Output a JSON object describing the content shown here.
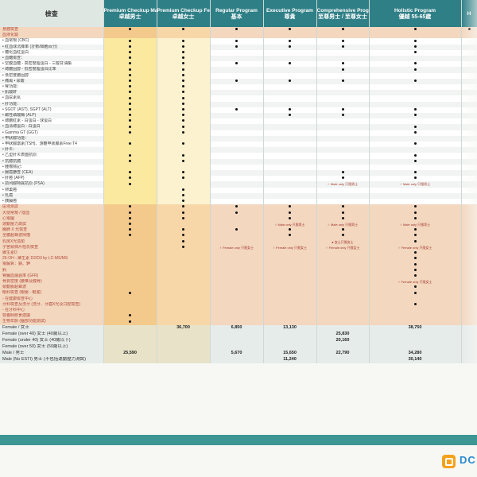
{
  "brand_text": "DC",
  "columns": [
    {
      "en": "檢查",
      "zh": ""
    },
    {
      "en": "Premium Checkup Male",
      "zh": "卓越男士"
    },
    {
      "en": "Premium Checkup Female",
      "zh": "卓越女士"
    },
    {
      "en": "Regular Program",
      "zh": "基本"
    },
    {
      "en": "Executive Program",
      "zh": "尊貴"
    },
    {
      "en": "Comprehensive Program Male/Female",
      "zh": "至尊男士 / 至尊女士"
    },
    {
      "en": "Holistic Program",
      "zh": "優越 55-65歲"
    },
    {
      "en": "H",
      "zh": ""
    }
  ],
  "rows": [
    {
      "label": "身體檢查",
      "cat": true,
      "c": [
        "•",
        "•",
        "•",
        "•",
        "•",
        "•",
        "•"
      ]
    },
    {
      "label": "血液化驗",
      "cat": true,
      "c": [
        "",
        "",
        "",
        "",
        "",
        "",
        ""
      ]
    },
    {
      "label": "• 血常規 (CBC)",
      "c": [
        "•",
        "•",
        "•",
        "•",
        "•",
        "•",
        ""
      ]
    },
    {
      "label": "• 紅血球沉降率 (計數/細胞百分)",
      "c": [
        "•",
        "•",
        "•",
        "•",
        "•",
        "•",
        ""
      ]
    },
    {
      "label": "• 糖化血紅蛋白",
      "c": [
        "•",
        "•",
        "",
        "",
        "",
        "•",
        ""
      ]
    },
    {
      "label": "• 血糖檢查：",
      "c": [
        "•",
        "•",
        "",
        "",
        "",
        "",
        ""
      ]
    },
    {
      "label": "• 空腹血糖 - 高密度脂蛋白 - 三酸甘油酯",
      "c": [
        "•",
        "•",
        "•",
        "•",
        "•",
        "•",
        ""
      ]
    },
    {
      "label": "• 總膽固醇 - 低密度脂蛋白比率",
      "c": [
        "•",
        "•",
        "",
        "",
        "•",
        "•",
        ""
      ]
    },
    {
      "label": "• 低密度膽固醇",
      "c": [
        "•",
        "•",
        "",
        "",
        "",
        "",
        ""
      ]
    },
    {
      "label": "• 痛風 • 尿酸",
      "c": [
        "•",
        "•",
        "•",
        "•",
        "•",
        "•",
        ""
      ]
    },
    {
      "label": "• 腎功能：",
      "c": [
        "•",
        "•",
        "",
        "",
        "",
        "",
        ""
      ]
    },
    {
      "label": "• 肌酸酐",
      "c": [
        "•",
        "•",
        "",
        "",
        "",
        "",
        ""
      ]
    },
    {
      "label": "• 血尿素氮",
      "c": [
        "•",
        "•",
        "",
        "",
        "",
        "",
        ""
      ]
    },
    {
      "label": "• 肝功能：",
      "c": [
        "•",
        "•",
        "",
        "",
        "",
        "",
        ""
      ]
    },
    {
      "label": "• SGOT (AST), SGPT (ALT)",
      "c": [
        "•",
        "•",
        "•",
        "•",
        "•",
        "•",
        ""
      ]
    },
    {
      "label": "• 鹼性磷酸酶 (ALP)",
      "c": [
        "•",
        "•",
        "",
        "•",
        "•",
        "•",
        ""
      ]
    },
    {
      "label": "• 總膽紅素 - 白蛋白 - 球蛋白",
      "c": [
        "•",
        "•",
        "",
        "",
        "",
        "",
        ""
      ]
    },
    {
      "label": "• 血清總蛋白 - 白蛋白",
      "c": [
        "•",
        "•",
        "",
        "",
        "",
        "•",
        ""
      ]
    },
    {
      "label": "• Gamma GT (GGT)",
      "c": [
        "•",
        "•",
        "",
        "",
        "",
        "•",
        ""
      ]
    },
    {
      "label": "• 甲狀腺功能：",
      "c": [
        "",
        "",
        "",
        "",
        "",
        "",
        ""
      ]
    },
    {
      "label": "• 甲狀腺激素(TSH)、游離甲狀腺素Free T4",
      "c": [
        "•",
        "•",
        "",
        "",
        "",
        "•",
        ""
      ]
    },
    {
      "label": "• 肝炎：",
      "c": [
        "",
        "",
        "",
        "",
        "",
        "",
        ""
      ]
    },
    {
      "label": "• 乙型肝炎表面抗原",
      "c": [
        "•",
        "•",
        "",
        "",
        "",
        "•",
        ""
      ]
    },
    {
      "label": "• 抗體抗體",
      "c": [
        "•",
        "•",
        "",
        "",
        "",
        "•",
        ""
      ]
    },
    {
      "label": "• 腫瘤標記：",
      "c": [
        "",
        "",
        "",
        "",
        "",
        "",
        ""
      ]
    },
    {
      "label": "• 腸癌篩查 (CEA)",
      "c": [
        "•",
        "•",
        "",
        "",
        "•",
        "•",
        ""
      ]
    },
    {
      "label": "• 肝癌 (AFP)",
      "c": [
        "•",
        "•",
        "",
        "",
        "•",
        "•",
        ""
      ]
    },
    {
      "label": "• 前列腺特異抗原 (PSA)",
      "c": [
        "•",
        "",
        "",
        "",
        "♂ Male only 只限男士",
        "♂ Male only 只限男士",
        ""
      ]
    },
    {
      "label": "• 卵巢癌",
      "c": [
        "",
        "•",
        "",
        "",
        "",
        "",
        ""
      ]
    },
    {
      "label": "• 乳癌",
      "c": [
        "",
        "•",
        "",
        "",
        "",
        "",
        ""
      ]
    },
    {
      "label": "• 胰臟癌",
      "c": [
        "",
        "•",
        "",
        "",
        "",
        "",
        ""
      ]
    },
    {
      "label": "尿液測試",
      "cat": true,
      "c": [
        "•",
        "•",
        "•",
        "•",
        "•",
        "•",
        ""
      ]
    },
    {
      "label": "大便常規 / 隱血",
      "cat": true,
      "c": [
        "•",
        "•",
        "•",
        "•",
        "•",
        "•",
        ""
      ]
    },
    {
      "label": "心電圖",
      "cat": true,
      "c": [
        "•",
        "•",
        "",
        "•",
        "•",
        "•",
        ""
      ]
    },
    {
      "label": "運動壓力測試",
      "cat": true,
      "c": [
        "•",
        "",
        "",
        "♂ Male only 只限男士",
        "♂ Male only 只限男士",
        "♂ Male only 只限男士",
        ""
      ]
    },
    {
      "label": "胸肺 X 光檢查",
      "cat": true,
      "c": [
        "•",
        "•",
        "•",
        "•",
        "•",
        "•",
        ""
      ]
    },
    {
      "label": "全腹超聲波掃描",
      "cat": true,
      "c": [
        "•",
        "•",
        "",
        "•",
        "•",
        "•",
        ""
      ]
    },
    {
      "label": "乳房X光造影",
      "cat": true,
      "c": [
        "",
        "•",
        "",
        "",
        "● 女士只限女士",
        "•",
        ""
      ]
    },
    {
      "label": "子宮頸抹片柏氏檢查",
      "cat": true,
      "c": [
        "",
        "•",
        "♀ Female only 只限女士",
        "♀ Female only 只限女士",
        "♀ Female only 只限女士",
        "♀ Female only 只限女士",
        ""
      ]
    },
    {
      "label": "維生素D",
      "cat": true,
      "c": [
        "",
        "",
        "",
        "",
        "",
        "•",
        ""
      ]
    },
    {
      "label": "25-OH - 維生素 D2/D3 by LC-MS/MS",
      "cat": true,
      "c": [
        "",
        "",
        "",
        "",
        "",
        "•",
        ""
      ]
    },
    {
      "label": "電解質：鈉、鉀",
      "cat": true,
      "c": [
        "",
        "",
        "",
        "",
        "",
        "•",
        ""
      ]
    },
    {
      "label": "鈣",
      "cat": true,
      "c": [
        "",
        "",
        "",
        "",
        "",
        "•",
        ""
      ]
    },
    {
      "label": "腎臟血濾過率 (GFR)",
      "cat": true,
      "c": [
        "",
        "",
        "",
        "",
        "",
        "•",
        ""
      ]
    },
    {
      "label": "骨質密度 (腰椎及髖骨)",
      "cat": true,
      "c": [
        "",
        "",
        "",
        "",
        "",
        "♀ Female only 只限女士",
        ""
      ]
    },
    {
      "label": "頸動脈超聲波",
      "cat": true,
      "c": [
        "",
        "",
        "",
        "",
        "",
        "•",
        ""
      ]
    },
    {
      "label": "眼科檢查 (眼壓 - 眼底)",
      "cat": true,
      "c": [
        "•",
        "",
        "",
        "",
        "",
        "•",
        ""
      ]
    },
    {
      "label": "- 在健康檢查中心",
      "cat": true,
      "c": [
        "",
        "",
        "",
        "",
        "",
        "",
        ""
      ]
    },
    {
      "label": "牙科檢查及洗牙 (洗牙、牙齒X光及口腔檢查)",
      "cat": true,
      "c": [
        "",
        "",
        "",
        "",
        "",
        "•",
        ""
      ]
    },
    {
      "label": "- 在牙科中心",
      "cat": true,
      "c": [
        "",
        "",
        "",
        "",
        "",
        "",
        ""
      ]
    },
    {
      "label": "營養師飲食建議",
      "cat": true,
      "c": [
        "•",
        "",
        "",
        "",
        "",
        "",
        ""
      ]
    },
    {
      "label": "生物年齡 (腦部功能測試)",
      "cat": true,
      "c": [
        "•",
        "",
        "",
        "",
        "",
        "",
        ""
      ]
    }
  ],
  "prices": [
    {
      "label": "Female / 女士",
      "c": [
        "",
        "36,700",
        "6,850",
        "13,130",
        "",
        "38,750",
        ""
      ]
    },
    {
      "label": "Female (over 40) 女士 (40歲以上)",
      "c": [
        "",
        "",
        "",
        "",
        "25,830",
        "",
        ""
      ]
    },
    {
      "label": "Female (under 40) 女士 (40歲以下)",
      "c": [
        "",
        "",
        "",
        "",
        "20,160",
        "",
        ""
      ]
    },
    {
      "label": "Female (over 50) 女士 (50歲以上)",
      "c": [
        "",
        "",
        "",
        "",
        "",
        "",
        ""
      ]
    },
    {
      "label": "Male / 男士",
      "c": [
        "25,590",
        "",
        "5,670",
        "15,650",
        "22,790",
        "34,280",
        ""
      ]
    },
    {
      "label": "Male (No ESTI) 男士 (不包括運動壓力測試)",
      "c": [
        "",
        "",
        "",
        "11,240",
        "",
        "30,140",
        ""
      ]
    }
  ]
}
